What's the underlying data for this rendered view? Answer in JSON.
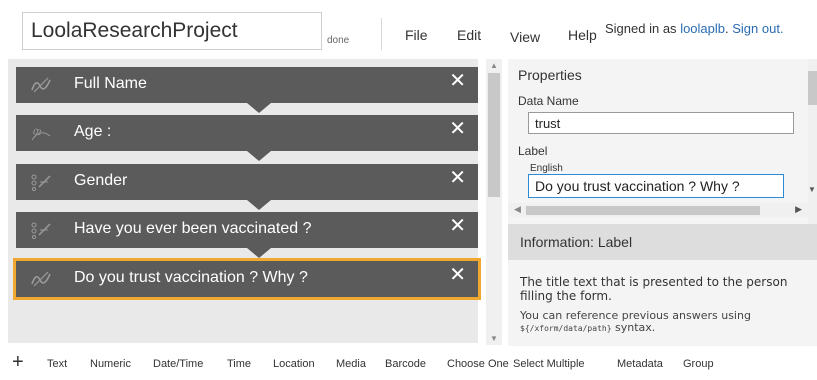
{
  "header": {
    "project_title": "LoolaResearchProject",
    "done_label": "done",
    "menu": [
      "File",
      "Edit",
      "View",
      "Help"
    ],
    "signin_prefix": "Signed in as",
    "username": "loolaplb",
    "signout": "Sign out."
  },
  "questions": [
    {
      "label": "Full Name",
      "icon": "text-question-icon",
      "selected": false
    },
    {
      "label": "Age :",
      "icon": "numeric-question-icon",
      "selected": false
    },
    {
      "label": "Gender",
      "icon": "choice-question-icon",
      "selected": false
    },
    {
      "label": "Have you ever been vaccinated ?",
      "icon": "choice-question-icon",
      "selected": false
    },
    {
      "label": "Do you trust vaccination ? Why ?",
      "icon": "text-question-icon",
      "selected": true
    }
  ],
  "properties": {
    "heading": "Properties",
    "data_name_label": "Data Name",
    "data_name_value": "trust",
    "label_label": "Label",
    "language": "English",
    "label_value": "Do you trust vaccination ? Why ?"
  },
  "info": {
    "heading": "Information: Label",
    "text1": "The title text that is presented to the person filling the form.",
    "text2_prefix": "You can reference previous answers using",
    "code": "${/xform/data/path}",
    "text2_suffix": "syntax."
  },
  "toolbar": {
    "add": "+",
    "items": [
      "Text",
      "Numeric",
      "Date/Time",
      "Time",
      "Location",
      "Media",
      "Barcode",
      "Choose One",
      "Select Multiple",
      "Metadata",
      "Group"
    ]
  },
  "colors": {
    "question_bg": "#5b5b5b",
    "selected_outline": "#f0a830",
    "link": "#2a6cb4",
    "focus_border": "#2a8bd6"
  }
}
